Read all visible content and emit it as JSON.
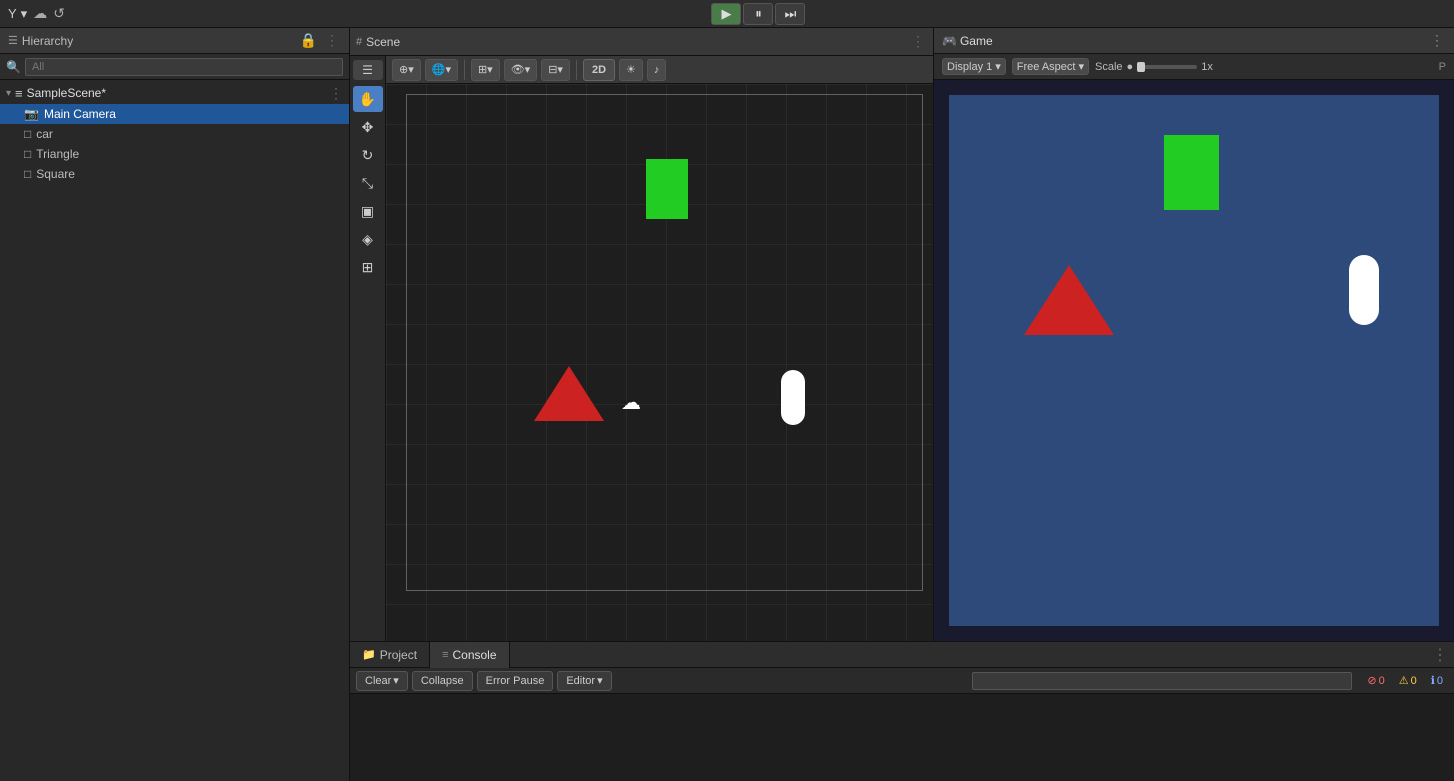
{
  "topbar": {
    "logo": "Y",
    "logo_dropdown": "▾",
    "cloud_label": "☁",
    "collab_label": "↺",
    "transport": {
      "play_label": "▶",
      "pause_label": "⏸",
      "step_label": "⏭"
    }
  },
  "hierarchy": {
    "title": "Hierarchy",
    "title_icon": "☰",
    "lock_icon": "🔒",
    "kebab": "⋮",
    "search_placeholder": "All",
    "scene_name": "SampleScene*",
    "scene_icon": "≡",
    "expand_arrow": "▾",
    "items": [
      {
        "name": "Main Camera",
        "icon": "📷",
        "indent": 1
      },
      {
        "name": "car",
        "icon": "□",
        "indent": 1
      },
      {
        "name": "Triangle",
        "icon": "□",
        "indent": 1
      },
      {
        "name": "Square",
        "icon": "□",
        "indent": 1
      }
    ]
  },
  "scene": {
    "title": "Scene",
    "title_icon": "#",
    "kebab": "⋮",
    "tools": {
      "hand": "✋",
      "move": "✥",
      "rotate": "↻",
      "scale": "⤡",
      "rect": "▣",
      "custom": "◈",
      "combo": "⊞"
    },
    "grid_icon": "⊞",
    "toggle_2d": "2D",
    "light_icon": "☀",
    "audio_icon": "♪",
    "display_dropdown": "Display 1",
    "aspect_label": "Free Aspect",
    "scale_label": "Scale",
    "scale_dot": "●",
    "scale_value": "1x",
    "p_label": "P"
  },
  "game": {
    "title": "Game",
    "title_icon": "🎮",
    "tab_label": "Game",
    "kebab": "⋮",
    "display_label": "Display 1",
    "aspect_label": "Free Aspect",
    "scale_label": "Scale",
    "scale_dot": "●",
    "scale_value": "1x",
    "p_label": "P"
  },
  "bottom": {
    "project_tab": "Project",
    "project_icon": "📁",
    "console_tab": "Console",
    "console_icon": "≡",
    "kebab": "⋮",
    "console_clear": "Clear",
    "console_clear_arrow": "▾",
    "console_collapse": "Collapse",
    "console_error_pause": "Error Pause",
    "console_editor": "Editor",
    "console_editor_arrow": "▾",
    "search_placeholder": "",
    "badge_error_icon": "⊘",
    "badge_error_count": "0",
    "badge_warning_icon": "⚠",
    "badge_warning_count": "0",
    "badge_info_icon": "ℹ",
    "badge_info_count": "0"
  },
  "colors": {
    "accent_blue": "#1f5799",
    "game_bg": "#2e4a7a",
    "green_shape": "#22cc22",
    "red_shape": "#cc2222",
    "panel_bg": "#282828",
    "toolbar_bg": "#383838"
  }
}
